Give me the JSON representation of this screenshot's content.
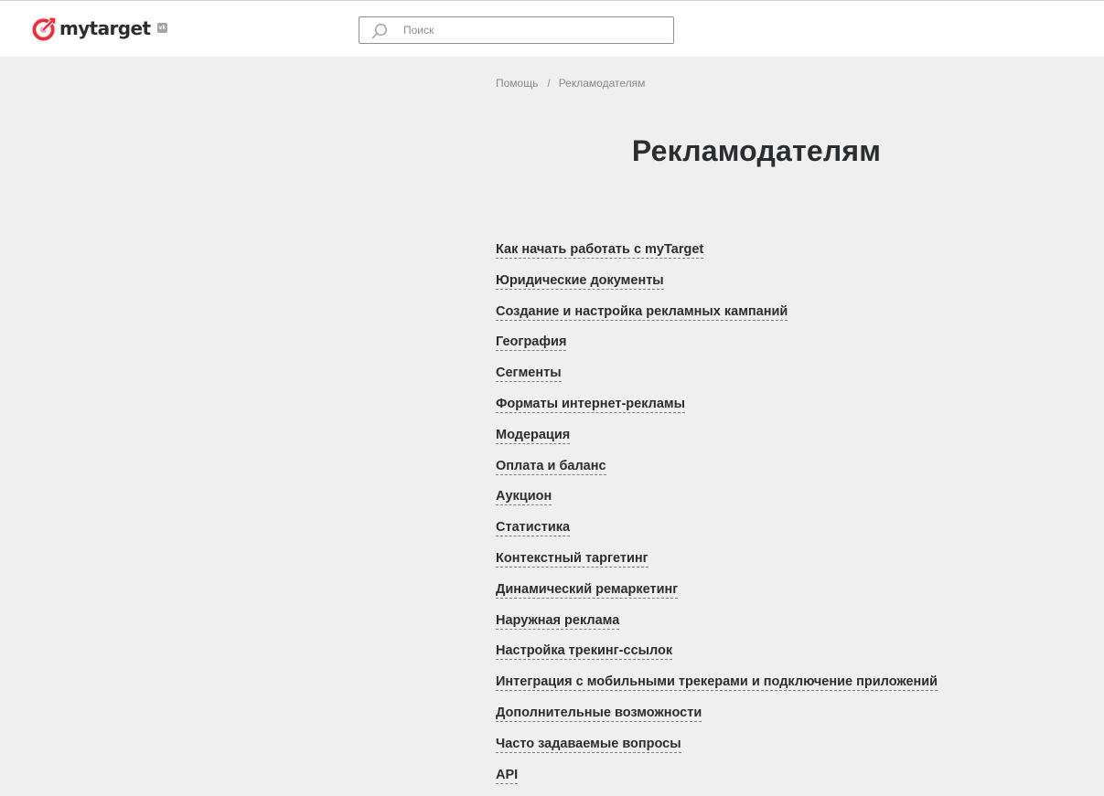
{
  "header": {
    "logo_text": "mytarget",
    "vk_badge": "vk",
    "search": {
      "placeholder": "Поиск",
      "value": ""
    }
  },
  "breadcrumb": {
    "items": [
      "Помощь",
      "Рекламодателям"
    ],
    "separator": "/"
  },
  "page": {
    "title": "Рекламодателям"
  },
  "topics": [
    "Как начать работать с myTarget",
    "Юридические документы",
    "Создание и настройка рекламных кампаний",
    "География",
    "Сегменты",
    "Форматы интернет-рекламы",
    "Модерация",
    "Оплата и баланс",
    "Аукцион",
    "Статистика",
    "Контекстный таргетинг",
    "Динамический ремаркетинг",
    "Наружная реклама",
    "Настройка трекинг-ссылок",
    "Интеграция с мобильными трекерами и подключение приложений",
    "Дополнительные возможности",
    "Часто задаваемые вопросы",
    "API"
  ],
  "colors": {
    "brand_red": "#ed2e3b",
    "page_background": "#efeff0",
    "text": "#2c2d2e",
    "muted_text": "#8a8a8e"
  }
}
